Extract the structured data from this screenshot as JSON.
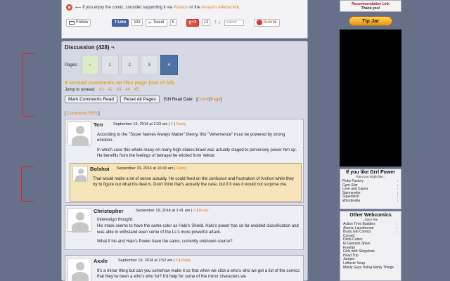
{
  "support": {
    "arrow": "⟵",
    "text_pre": "If you enjoy the comic, consider supporting it via",
    "patreon": "Patreon",
    "or": "or the",
    "amazon": "Amazon referral link",
    "end": "."
  },
  "share": {
    "email_follow": "Follow",
    "fb_like": "Like",
    "fb_count": "103",
    "tweet": "Tweet",
    "tweet_count": "5",
    "gplus": "g+1",
    "gplus_count": "12",
    "submit_placeholder": "submit",
    "reddit_submit": "Submit"
  },
  "discussion": {
    "title": "Discussion (428)",
    "title_suffix": "¬",
    "pages_label": "Pages:",
    "pages": [
      {
        "label": "«",
        "state": "prev"
      },
      {
        "label": "1",
        "state": "normal"
      },
      {
        "label": "2",
        "state": "normal"
      },
      {
        "label": "3",
        "state": "normal"
      },
      {
        "label": "4",
        "state": "current"
      }
    ],
    "unread": "5 unread comments on this page (out of 18).",
    "jump_label": "Jump to unread:",
    "jump_links": [
      "#1",
      "#2",
      "#3",
      "#4",
      "#5"
    ],
    "mark_btn": "Mark Comments Read",
    "reset_btn": "Reset All Pages",
    "edit_read_label": "Edit Read Date:",
    "edit_comic": "Comic",
    "edit_page": "Page",
    "rss": "Comments RSS"
  },
  "comments": [
    {
      "author": "Terr",
      "date": "September 19, 2014 at 2:23 am",
      "permalink": "#",
      "reply": "Reply",
      "paragraphs": [
        "According to the \"Super Names Always Matter\" theory, this \"Vehemence\" must be powered by strong emotion.",
        "In which case this whole many-on-many high-stakes brawl was actually staged to perversely power him up. He benefits from the feelings of betrayal he elicited from Vektor."
      ]
    },
    {
      "author": "Bolshoi",
      "date": "September 19, 2014 at 10:43 am",
      "permalink": "",
      "reply": "Reply",
      "paragraphs": [
        "That would make a lot of sense actually. He could feed on the confusion and frustration of Archon while they try to figure out what his deal is. Don't think that's actually the case, but if it was it would not surprise me."
      ]
    },
    {
      "author": "Christopher",
      "date": "September 19, 2014 at 2:41 am",
      "permalink": "#",
      "reply": "Reply",
      "paragraphs": [
        "Interestign thought:",
        "His mask seems to have the same color as Halo's Shield. Halo's power has so far avoided classification and was able to withstand even some of the LL's more powerful attack.",
        "What if his and Halo's Power have the same, currently unknown source?"
      ]
    },
    {
      "author": "Axxle",
      "date": "September 19, 2014 at 2:52 am",
      "permalink": "#",
      "reply": "Reply",
      "paragraphs": [
        "It's a minor thing but can you somehow make it so that when we click a who's who we get a list of the comics that they've been a who's who for? It'd help for some of the minor characters we"
      ]
    }
  ],
  "sidebar": {
    "rec_line1": "Recommendation Link",
    "rec_line2": "Thank you!",
    "tip_jar": "Tip Jar",
    "grrl_title": "If you like Grrl Power",
    "grrl_sub": "Then you might like...",
    "grrl_links": [
      "Fluky Factory",
      "Gyro-Star",
      "Love and Capes",
      "Spinnerette",
      "Superbitch",
      "Wonderella"
    ],
    "other_title": "Other Webcomics",
    "other_sub": "...that I like.",
    "other_links": [
      "Action Time Buddies",
      "Atomic Laundromat",
      "Busty Girl Comics",
      "Cursed",
      "Demi Cubes",
      "El Goonish Shive",
      "Freefall",
      "Girls with Slingshots",
      "Head Trip",
      "Jumper",
      "Leftover Soup",
      "Manly Guys Doing Manly Things"
    ]
  },
  "colors": {
    "background": "#667088",
    "accent_link": "#e37a16",
    "unread": "#e8a21a",
    "current_page": "#4d73a6",
    "reply_bg": "#f7e4b8"
  }
}
